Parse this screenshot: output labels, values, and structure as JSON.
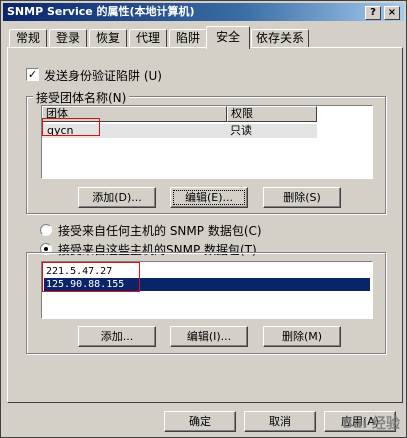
{
  "window": {
    "title": "SNMP Service 的属性(本地计算机)",
    "help_button": "?",
    "close_button": "×"
  },
  "tabs": [
    {
      "label": "常规"
    },
    {
      "label": "登录"
    },
    {
      "label": "恢复"
    },
    {
      "label": "代理"
    },
    {
      "label": "陷阱"
    },
    {
      "label": "安全",
      "active": true
    },
    {
      "label": "依存关系"
    }
  ],
  "security": {
    "send_auth_trap": {
      "label": "发送身份验证陷阱 (U)",
      "checked": true,
      "check_mark": "✓"
    },
    "communities": {
      "group_label": "接受团体名称(N)",
      "columns": [
        "团体",
        "权限"
      ],
      "rows": [
        {
          "community": "qycn",
          "rights": "只读"
        }
      ],
      "buttons": {
        "add": "添加(D)...",
        "edit": "编辑(E)...",
        "remove": "删除(S)"
      }
    },
    "accept_any": {
      "label": "接受来自任何主机的 SNMP 数据包(C)",
      "selected": false
    },
    "accept_these": {
      "label": "接受来自这些主机的SNMP 数据包(T)",
      "selected": true
    },
    "hosts": [
      "221.5.47.27",
      "125.90.88.155"
    ],
    "host_buttons": {
      "add": "添加...",
      "edit": "编辑(I)...",
      "remove": "删除(M)"
    }
  },
  "footer": {
    "ok": "确定",
    "cancel": "取消",
    "apply": "应用(A)"
  },
  "watermark": "Bai 经验"
}
